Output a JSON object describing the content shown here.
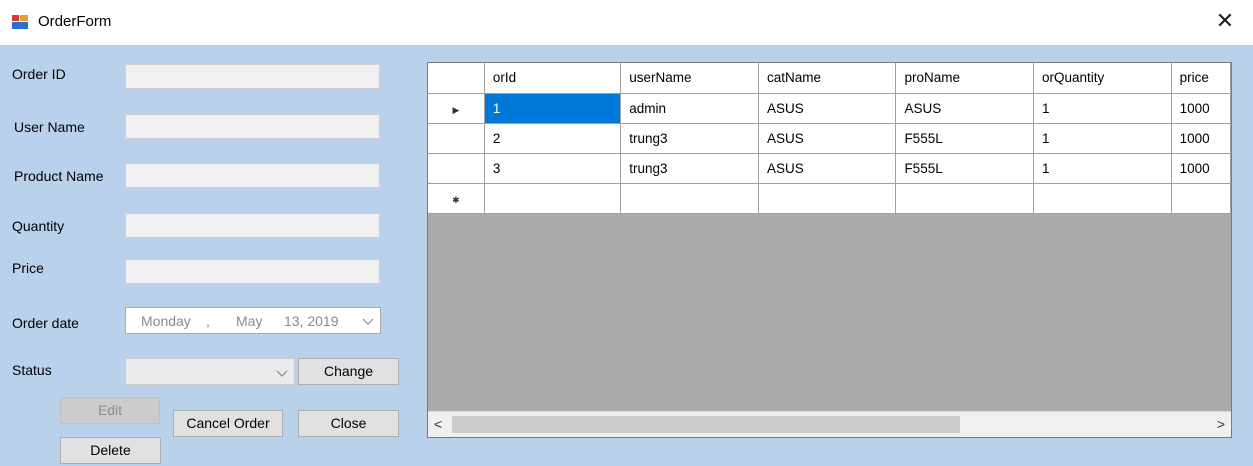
{
  "window": {
    "title": "OrderForm",
    "close_glyph": "✕"
  },
  "form": {
    "order_id_label": "Order ID",
    "user_name_label": "User Name",
    "product_name_label": "Product Name",
    "quantity_label": "Quantity",
    "price_label": "Price",
    "order_date_label": "Order date",
    "status_label": "Status",
    "order_id_value": "",
    "user_name_value": "",
    "product_name_value": "",
    "quantity_value": "",
    "price_value": "",
    "order_date": {
      "weekday": "Monday",
      "sep": ",",
      "month": "May",
      "rest": "13, 2019"
    },
    "status_value": ""
  },
  "buttons": {
    "change": "Change",
    "edit": "Edit",
    "cancel_order": "Cancel Order",
    "close": "Close",
    "delete": "Delete"
  },
  "grid": {
    "columns": [
      "orId",
      "userName",
      "catName",
      "proName",
      "orQuantity",
      "price"
    ],
    "rows": [
      [
        "1",
        "admin",
        "ASUS",
        "ASUS",
        "1",
        "1000"
      ],
      [
        "2",
        "trung3",
        "ASUS",
        "F555L",
        "1",
        "1000"
      ],
      [
        "3",
        "trung3",
        "ASUS",
        "F555L",
        "1",
        "1000"
      ]
    ],
    "current_row_marker": "▶",
    "new_row_marker": "✱",
    "scroll_left": "<",
    "scroll_right": ">"
  },
  "colors": {
    "form_bg": "#b9d1ea",
    "selection": "#0078d7",
    "grid_empty": "#ababab"
  }
}
